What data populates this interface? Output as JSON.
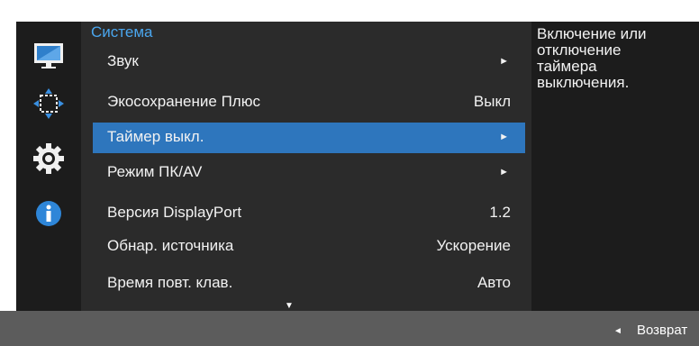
{
  "menu": {
    "title": "Система",
    "items": [
      {
        "label": "Звук",
        "value": "",
        "has_arrow": true
      },
      {
        "label": "Экосохранение Плюс",
        "value": "Выкл",
        "has_arrow": false
      },
      {
        "label": "Таймер выкл.",
        "value": "",
        "has_arrow": true,
        "selected": true
      },
      {
        "label": "Режим ПК/AV",
        "value": "",
        "has_arrow": true
      },
      {
        "label": "Версия DisplayPort",
        "value": "1.2",
        "has_arrow": false
      },
      {
        "label": "Обнар. источника",
        "value": "Ускорение",
        "has_arrow": false
      },
      {
        "label": "Время повт. клав.",
        "value": "Авто",
        "has_arrow": false
      }
    ],
    "more_indicator": "▼"
  },
  "sidebar": {
    "icons": [
      "picture-icon",
      "position-icon",
      "system-gear-icon",
      "information-icon"
    ]
  },
  "info": {
    "text_lines": [
      "Включение или",
      "отключение",
      "таймера",
      "выключения."
    ]
  },
  "footer": {
    "return_arrow": "◄",
    "return_label": "Возврат"
  },
  "colors": {
    "accent_title": "#4aa6ee",
    "selection": "#2e76bd",
    "menu_bg": "#2b2b2b",
    "panel_bg": "#1c1c1c",
    "bottom_bar": "#5c5c5c"
  }
}
